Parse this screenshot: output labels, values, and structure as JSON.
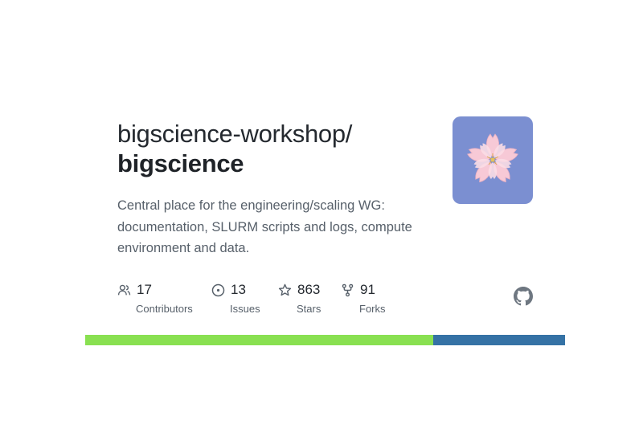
{
  "repo": {
    "owner": "bigscience-workshop/",
    "name": "bigscience",
    "description": "Central place for the engineering/scaling WG: documentation, SLURM scripts and logs, compute environment and data."
  },
  "stats": [
    {
      "icon": "people-icon",
      "value": "17",
      "label": "Contributors"
    },
    {
      "icon": "issue-circle-icon",
      "value": "13",
      "label": "Issues"
    },
    {
      "icon": "star-icon",
      "value": "863",
      "label": "Stars"
    },
    {
      "icon": "fork-icon",
      "value": "91",
      "label": "Forks"
    }
  ],
  "avatar": {
    "icon": "cherry-blossom-icon",
    "background": "#7b8fd1",
    "petal_color": "#f5c6d3"
  },
  "github_logo": "github-octocat-icon",
  "language_bar": [
    {
      "color": "#89e051",
      "fraction": 0.725
    },
    {
      "color": "#3572a5",
      "fraction": 0.275
    }
  ]
}
